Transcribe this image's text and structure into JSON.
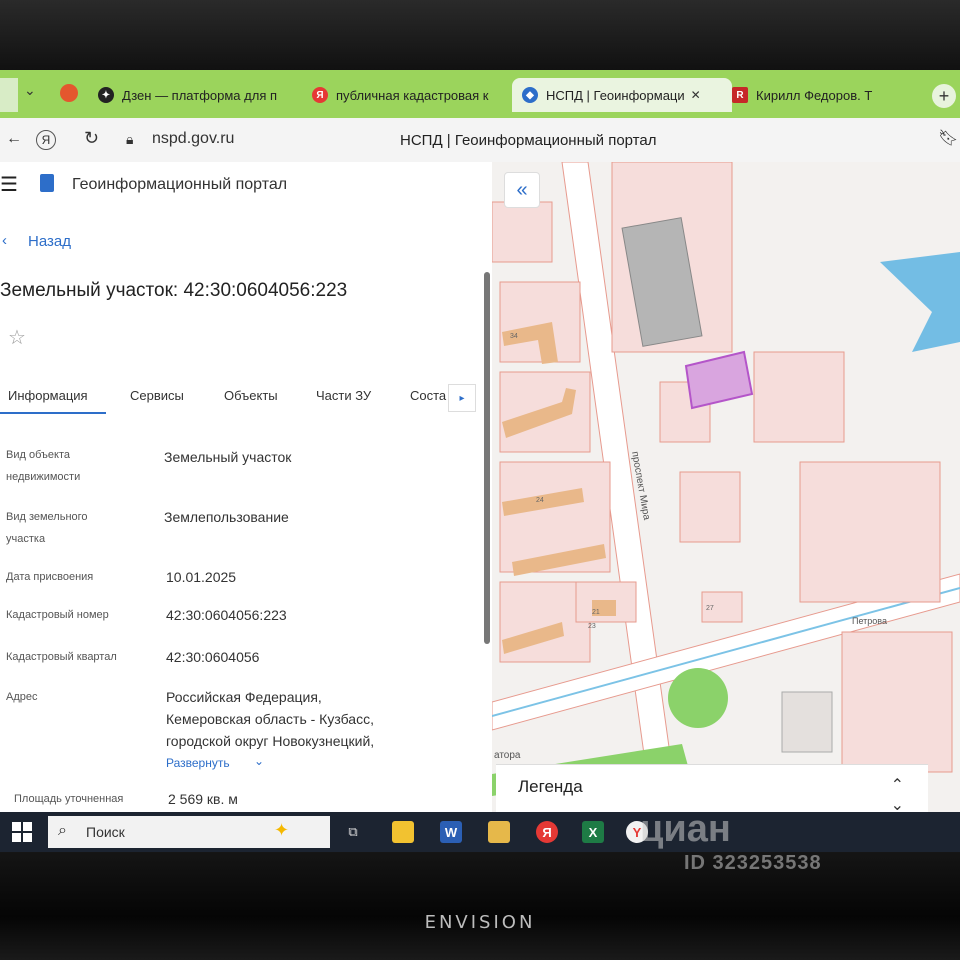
{
  "browser": {
    "tabs": [
      {
        "label": "Дзен — платформа для п",
        "icon": "dzen-icon",
        "color": "#222222"
      },
      {
        "label": "публичная кадастровая к",
        "icon": "yandex-icon",
        "color": "#e53935"
      },
      {
        "label": "НСПД | Геоинформаци",
        "icon": "nspd-icon",
        "color": "#2d6ec9"
      },
      {
        "label": "Кирилл Федоров. Т",
        "icon": "r-icon",
        "color": "#c62828"
      }
    ],
    "url": "nspd.gov.ru",
    "page_title": "НСПД | Геоинформационный портал"
  },
  "sidebar": {
    "portal_title": "Геоинформационный портал",
    "back_label": "Назад",
    "heading": "Земельный участок: 42:30:0604056:223",
    "tabs": [
      "Информация",
      "Сервисы",
      "Объекты",
      "Части ЗУ",
      "Соста"
    ],
    "fields": [
      {
        "label_lines": [
          "Вид объекта",
          "недвижимости"
        ],
        "value": "Земельный участок"
      },
      {
        "label_lines": [
          "Вид земельного",
          "участка"
        ],
        "value": "Землепользование"
      },
      {
        "label_lines": [
          "Дата присвоения"
        ],
        "value": "10.01.2025"
      },
      {
        "label_lines": [
          "Кадастровый номер"
        ],
        "value": "42:30:0604056:223"
      },
      {
        "label_lines": [
          "Кадастровый квартал"
        ],
        "value": "42:30:0604056"
      },
      {
        "label_lines": [
          "Адрес"
        ],
        "value_lines": [
          "Российская Федерация,",
          "Кемеровская область - Кузбасс,",
          "городской округ Новокузнецкий,"
        ]
      },
      {
        "label_lines": [
          "Площадь уточненная"
        ],
        "value": "2 569 кв. м"
      }
    ],
    "expand_label": "Развернуть"
  },
  "map": {
    "street_label": "проспект Мира",
    "street_label_2": "Петрова",
    "street_label_3": "атора",
    "building_numbers": [
      "34",
      "24",
      "21",
      "23",
      "27"
    ],
    "legend_label": "Легенда",
    "highlight_color": "#b455c9"
  },
  "taskbar": {
    "search_label": "Поиск"
  },
  "watermark": {
    "brand": "циан",
    "id": "ID 323253538"
  },
  "monitor": {
    "brand": "ENVISION"
  }
}
